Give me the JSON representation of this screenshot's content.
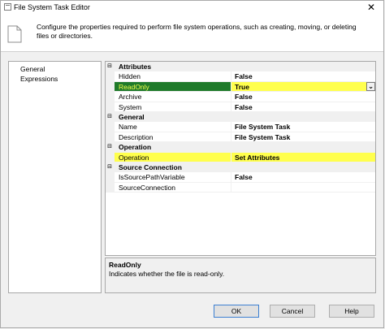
{
  "window": {
    "title": "File System Task Editor",
    "close_glyph": "✕"
  },
  "header": {
    "description": "Configure the properties required to perform file system operations, such as creating, moving, or deleting files or directories."
  },
  "nav": {
    "items": [
      "General",
      "Expressions"
    ]
  },
  "grid": {
    "categories": {
      "attributes": "Attributes",
      "general": "General",
      "operation": "Operation",
      "source": "Source Connection"
    },
    "attributes": {
      "hidden": {
        "name": "Hidden",
        "value": "False"
      },
      "readonly": {
        "name": "ReadOnly",
        "value": "True"
      },
      "archive": {
        "name": "Archive",
        "value": "False"
      },
      "system": {
        "name": "System",
        "value": "False"
      }
    },
    "general": {
      "name": {
        "name": "Name",
        "value": "File System Task"
      },
      "description": {
        "name": "Description",
        "value": "File System Task"
      }
    },
    "operation": {
      "operation": {
        "name": "Operation",
        "value": "Set Attributes"
      }
    },
    "source": {
      "is_var": {
        "name": "IsSourcePathVariable",
        "value": "False"
      },
      "conn": {
        "name": "SourceConnection",
        "value": ""
      }
    },
    "collapse_glyph": "⊟",
    "dropdown_glyph": "⌄"
  },
  "desc": {
    "title": "ReadOnly",
    "text": "Indicates whether the file is read-only."
  },
  "buttons": {
    "ok": "OK",
    "cancel": "Cancel",
    "help": "Help"
  },
  "colors": {
    "highlight_green": "#1f7a2a",
    "highlight_yellow": "#ffff4d"
  }
}
